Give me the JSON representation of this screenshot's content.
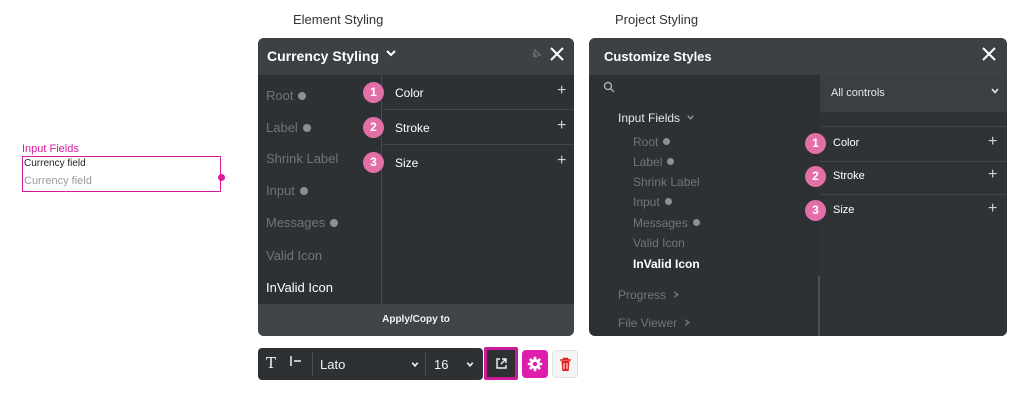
{
  "captions": {
    "element_styling": "Element Styling",
    "project_styling": "Project Styling"
  },
  "input_preview": {
    "group_label": "Input Fields",
    "field_label": "Currency field",
    "placeholder": "Currency field"
  },
  "element_panel": {
    "title": "Currency Styling",
    "nav": [
      "Root",
      "Label",
      "Shrink Label",
      "Input",
      "Messages",
      "Valid Icon",
      "InValid Icon"
    ],
    "active_nav": "InValid Icon",
    "properties": [
      {
        "num": "1",
        "label": "Color"
      },
      {
        "num": "2",
        "label": "Stroke"
      },
      {
        "num": "3",
        "label": "Size"
      }
    ],
    "footer_button": "Apply/Copy to"
  },
  "project_panel": {
    "title": "Customize Styles",
    "filter": "All controls",
    "tree_head": "Input Fields",
    "tree": [
      "Root",
      "Label",
      "Shrink Label",
      "Input",
      "Messages",
      "Valid Icon",
      "InValid Icon"
    ],
    "tree_after": [
      "Progress",
      "File Viewer"
    ],
    "properties": [
      {
        "num": "1",
        "label": "Color"
      },
      {
        "num": "2",
        "label": "Stroke"
      },
      {
        "num": "3",
        "label": "Size"
      }
    ]
  },
  "toolbar": {
    "font": "Lato",
    "size": "16"
  },
  "colors": {
    "accent": "#d81b9c",
    "panel": "#2d3133",
    "badge": "#e36fa9"
  }
}
